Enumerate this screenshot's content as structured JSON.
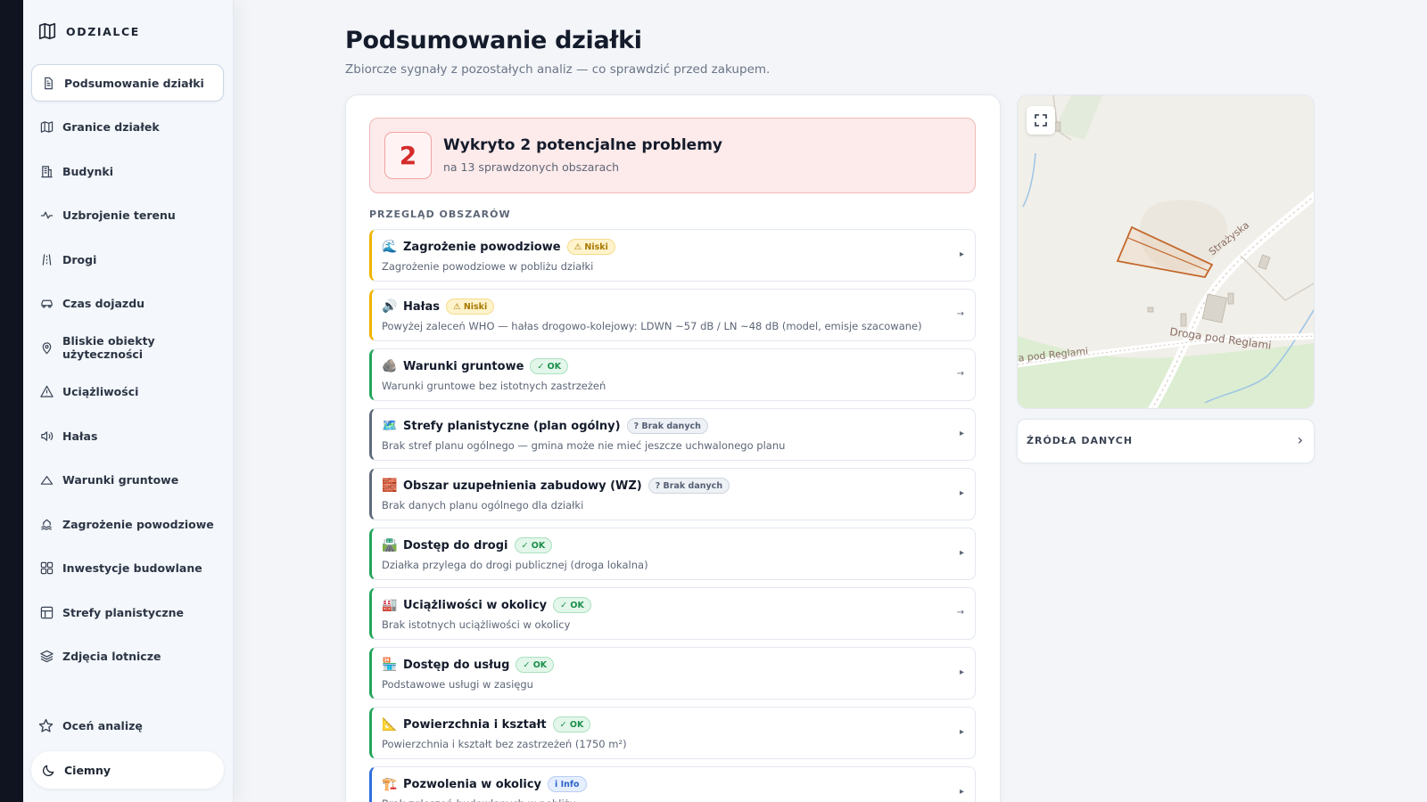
{
  "brand": {
    "name": "ODZIALCE"
  },
  "sidebar": {
    "items": [
      {
        "label": "Podsumowanie działki",
        "icon": "document-icon",
        "active": true
      },
      {
        "label": "Granice działek",
        "icon": "map-icon"
      },
      {
        "label": "Budynki",
        "icon": "building-icon"
      },
      {
        "label": "Uzbrojenie terenu",
        "icon": "pulse-icon"
      },
      {
        "label": "Drogi",
        "icon": "road-icon"
      },
      {
        "label": "Czas dojazdu",
        "icon": "car-icon"
      },
      {
        "label": "Bliskie obiekty użyteczności",
        "icon": "pin-icon"
      },
      {
        "label": "Uciążliwości",
        "icon": "warning-icon"
      },
      {
        "label": "Hałas",
        "icon": "speaker-icon"
      },
      {
        "label": "Warunki gruntowe",
        "icon": "mountain-icon"
      },
      {
        "label": "Zagrożenie powodziowe",
        "icon": "flood-icon"
      },
      {
        "label": "Inwestycje budowlane",
        "icon": "grid-icon"
      },
      {
        "label": "Strefy planistyczne",
        "icon": "zones-icon"
      },
      {
        "label": "Zdjęcia lotnicze",
        "icon": "layers-icon"
      }
    ],
    "rate_label": "Oceń analizę",
    "theme_label": "Ciemny"
  },
  "header": {
    "title": "Podsumowanie działki",
    "subtitle": "Zbiorcze sygnały z pozostałych analiz — co sprawdzić przed zakupem."
  },
  "alert": {
    "count": "2",
    "title": "Wykryto 2 potencjalne problemy",
    "subtitle": "na 13 sprawdzonych obszarach"
  },
  "overview": {
    "label": "PRZEGLĄD OBSZARÓW",
    "rows": [
      {
        "emoji": "🌊",
        "title": "Zagrożenie powodziowe",
        "badge": "⚠ Niski",
        "badge_type": "warn",
        "color": "yellow",
        "desc": "Zagrożenie powodziowe w pobliżu działki",
        "arrow": "▸"
      },
      {
        "emoji": "🔊",
        "title": "Hałas",
        "badge": "⚠ Niski",
        "badge_type": "warn",
        "color": "yellow",
        "desc": "Powyżej zaleceń WHO — hałas drogowo-kolejowy: LDWN ~57 dB / LN ~48 dB (model, emisje szacowane)",
        "arrow": "→"
      },
      {
        "emoji": "🪨",
        "title": "Warunki gruntowe",
        "badge": "✓ OK",
        "badge_type": "ok",
        "color": "green",
        "desc": "Warunki gruntowe bez istotnych zastrzeżeń",
        "arrow": "→"
      },
      {
        "emoji": "🗺️",
        "title": "Strefy planistyczne (plan ogólny)",
        "badge": "? Brak danych",
        "badge_type": "nodata",
        "color": "gray",
        "desc": "Brak stref planu ogólnego — gmina może nie mieć jeszcze uchwalonego planu",
        "arrow": "▸"
      },
      {
        "emoji": "🧱",
        "title": "Obszar uzupełnienia zabudowy (WZ)",
        "badge": "? Brak danych",
        "badge_type": "nodata",
        "color": "gray",
        "desc": "Brak danych planu ogólnego dla działki",
        "arrow": "▸"
      },
      {
        "emoji": "🛣️",
        "title": "Dostęp do drogi",
        "badge": "✓ OK",
        "badge_type": "ok",
        "color": "green",
        "desc": "Działka przylega do drogi publicznej (droga lokalna)",
        "arrow": "▸"
      },
      {
        "emoji": "🏭",
        "title": "Uciążliwości w okolicy",
        "badge": "✓ OK",
        "badge_type": "ok",
        "color": "green",
        "desc": "Brak istotnych uciążliwości w okolicy",
        "arrow": "→"
      },
      {
        "emoji": "🏪",
        "title": "Dostęp do usług",
        "badge": "✓ OK",
        "badge_type": "ok",
        "color": "green",
        "desc": "Podstawowe usługi w zasięgu",
        "arrow": "▸"
      },
      {
        "emoji": "📐",
        "title": "Powierzchnia i kształt",
        "badge": "✓ OK",
        "badge_type": "ok",
        "color": "green",
        "desc": "Powierzchnia i kształt bez zastrzeżeń (1750 m²)",
        "arrow": "▸"
      },
      {
        "emoji": "🏗️",
        "title": "Pozwolenia w okolicy",
        "badge": "i Info",
        "badge_type": "info",
        "color": "blue",
        "desc": "Brak zgłoszeń budowlanych w pobliżu",
        "arrow": "▸"
      }
    ]
  },
  "map": {
    "street_1": "Strażyska",
    "street_2": "Droga pod Reglami",
    "street_3": "Droga pod Reglami",
    "fullscreen_icon": "fullscreen-icon"
  },
  "sources": {
    "label": "ŹRÓDŁA DANYCH"
  }
}
